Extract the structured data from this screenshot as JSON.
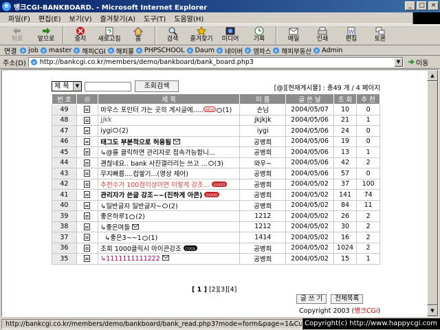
{
  "window": {
    "title": "뱅크CGI-BANKBOARD. - Microsoft Internet Explorer"
  },
  "menu": [
    "파일(F)",
    "편집(E)",
    "보기(V)",
    "즐겨찾기(A)",
    "도구(T)",
    "도움말(H)"
  ],
  "toolbar": [
    {
      "label": "뒤로",
      "icon": "back-arrow-icon",
      "disabled": true
    },
    {
      "label": "앞으로",
      "icon": "forward-arrow-icon",
      "disabled": false
    },
    {
      "label": "중지",
      "icon": "stop-icon",
      "disabled": false
    },
    {
      "label": "새로고침",
      "icon": "refresh-icon",
      "disabled": false
    },
    {
      "label": "홈",
      "icon": "home-icon",
      "disabled": false
    },
    {
      "label": "검색",
      "icon": "search-icon",
      "disabled": false
    },
    {
      "label": "즐겨찾기",
      "icon": "favorites-icon",
      "disabled": false
    },
    {
      "label": "미디어",
      "icon": "media-icon",
      "disabled": false
    },
    {
      "label": "기록",
      "icon": "history-icon",
      "disabled": false
    },
    {
      "label": "메일",
      "icon": "mail-icon",
      "disabled": false
    },
    {
      "label": "인쇄",
      "icon": "print-icon",
      "disabled": false
    },
    {
      "label": "편집",
      "icon": "edit-icon",
      "disabled": false
    },
    {
      "label": "토론",
      "icon": "discuss-icon",
      "disabled": false
    }
  ],
  "links": {
    "header": "연결",
    "items": [
      "job",
      "master",
      "해피CGI",
      "해피몰",
      "PHPSCHOOL",
      "Daum",
      "네이버",
      "엠파스",
      "해피부동산",
      "Admin"
    ]
  },
  "address": {
    "header": "주소(D)",
    "url": "http://bankcgi.co.kr/members/demo/bankboard/bank_board.php3",
    "go": "이동"
  },
  "board": {
    "search_select": "제 목",
    "search_button": "조회검색",
    "count_text": "[@][현재게시물] : 총49 개 / 4 페이지",
    "headers": [
      "번 호",
      "◎",
      "제   목",
      "이   름",
      "글 쓴 날",
      "조 회",
      "추 천"
    ],
    "rows": [
      {
        "no": "49",
        "title": "마우스 포인터 가는 곳의 게시글에.....",
        "title_extra": "(1)",
        "badge": "new",
        "name": "손님",
        "date": "2004/05/07",
        "views": "10",
        "rec": "0",
        "bold": false,
        "color": "#000000",
        "comment": true,
        "indent": false
      },
      {
        "no": "48",
        "title": "jjkk",
        "title_extra": "",
        "badge": "",
        "name": "jkjkjk",
        "date": "2004/05/06",
        "views": "21",
        "rec": "1",
        "bold": false,
        "color": "#555555",
        "comment": false,
        "indent": false
      },
      {
        "no": "47",
        "title": "iygi",
        "title_extra": "(2)",
        "badge": "",
        "name": "iygi",
        "date": "2004/05/06",
        "views": "24",
        "rec": "0",
        "bold": false,
        "color": "#000000",
        "comment": true,
        "indent": false
      },
      {
        "no": "46",
        "title": "태그도 부분적으로 허용됨",
        "title_extra": "",
        "badge": "mail",
        "name": "공병희",
        "date": "2004/05/06",
        "views": "19",
        "rec": "0",
        "bold": true,
        "color": "#000000",
        "comment": false,
        "indent": false
      },
      {
        "no": "45",
        "title": "↳@를 클릭하면 관리자로 접속가능합니...",
        "title_extra": "",
        "badge": "",
        "name": "공병희",
        "date": "2004/05/06",
        "views": "13",
        "rec": "1",
        "bold": false,
        "color": "#000000",
        "comment": false,
        "indent": false
      },
      {
        "no": "44",
        "title": "괜찮네요.. bank 사진갤러리는 쓰고 ...",
        "title_extra": "(3)",
        "badge": "",
        "name": "와우~",
        "date": "2004/05/06",
        "views": "42",
        "rec": "2",
        "bold": false,
        "color": "#000000",
        "comment": true,
        "indent": false
      },
      {
        "no": "43",
        "title": "무지빠름....컵쌓기...(영상 제어)",
        "title_extra": "",
        "badge": "",
        "name": "공병희",
        "date": "2004/05/06",
        "views": "57",
        "rec": "0",
        "bold": false,
        "color": "#000000",
        "comment": false,
        "indent": false
      },
      {
        "no": "42",
        "title": "추천수가 100점이상이면 이렇게 강조...",
        "title_extra": "",
        "badge": "good",
        "name": "공병희",
        "date": "2004/05/02",
        "views": "37",
        "rec": "100",
        "bold": false,
        "color": "#d04040",
        "comment": false,
        "indent": false
      },
      {
        "no": "41",
        "title": "관리자가 쓴글 강조~~(진하게 아콘)",
        "title_extra": "",
        "badge": "good",
        "name": "공병희",
        "date": "2004/05/02",
        "views": "141",
        "rec": "74",
        "bold": true,
        "color": "#000000",
        "comment": false,
        "indent": false
      },
      {
        "no": "40",
        "title": "↳일반글자 일반글자~",
        "title_extra": "(2)",
        "badge": "",
        "name": "공병희",
        "date": "2004/05/02",
        "views": "84",
        "rec": "11",
        "bold": false,
        "color": "#000000",
        "comment": true,
        "indent": false
      },
      {
        "no": "39",
        "title": "좋은하루1",
        "title_extra": "(2)",
        "badge": "",
        "name": "1212",
        "date": "2004/05/02",
        "views": "26",
        "rec": "2",
        "bold": false,
        "color": "#000000",
        "comment": true,
        "indent": false
      },
      {
        "no": "38",
        "title": "↳좋은며들",
        "title_extra": "",
        "badge": "mail",
        "name": "1212",
        "date": "2004/05/02",
        "views": "30",
        "rec": "2",
        "bold": false,
        "color": "#000000",
        "comment": false,
        "indent": false
      },
      {
        "no": "37",
        "title": "↳좋은3~~1",
        "title_extra": "(1)",
        "badge": "",
        "name": "1414",
        "date": "2004/05/02",
        "views": "16",
        "rec": "2",
        "bold": false,
        "color": "#000000",
        "comment": true,
        "indent": true
      },
      {
        "no": "36",
        "title": "조회 1000클릭시 아이콘강조",
        "title_extra": "",
        "badge": "cool",
        "name": "공병희",
        "date": "2004/05/02",
        "views": "1024",
        "rec": "2",
        "bold": false,
        "color": "#000000",
        "comment": false,
        "indent": false
      },
      {
        "no": "35",
        "title": "↳1111111111222",
        "title_extra": "",
        "badge": "mail",
        "name": "공병희",
        "date": "2004/05/02",
        "views": "15",
        "rec": "1",
        "bold": false,
        "color": "#a00060",
        "comment": false,
        "indent": false
      }
    ],
    "pager": {
      "current": "[ 1 ]",
      "others": [
        "[2]",
        "[3]",
        "[4]"
      ]
    },
    "write_button": "글 쓰 기",
    "list_button": "전체목록",
    "copyright_prefix": "Copyright 2003 (",
    "copyright_link": "뱅크CGi",
    "copyright_suffix": ")"
  },
  "status": {
    "url": "http://bankcgi.co.kr/members/demo/bankboard/bank_read.php3?mode=form&page=1&Cuid",
    "copyright": "Copyright(c) http://www.happycgi.com"
  },
  "colors": {
    "header_bg": "#8c8c8c",
    "title_bar": "#0a246a",
    "chrome": "#d4d0c8"
  }
}
